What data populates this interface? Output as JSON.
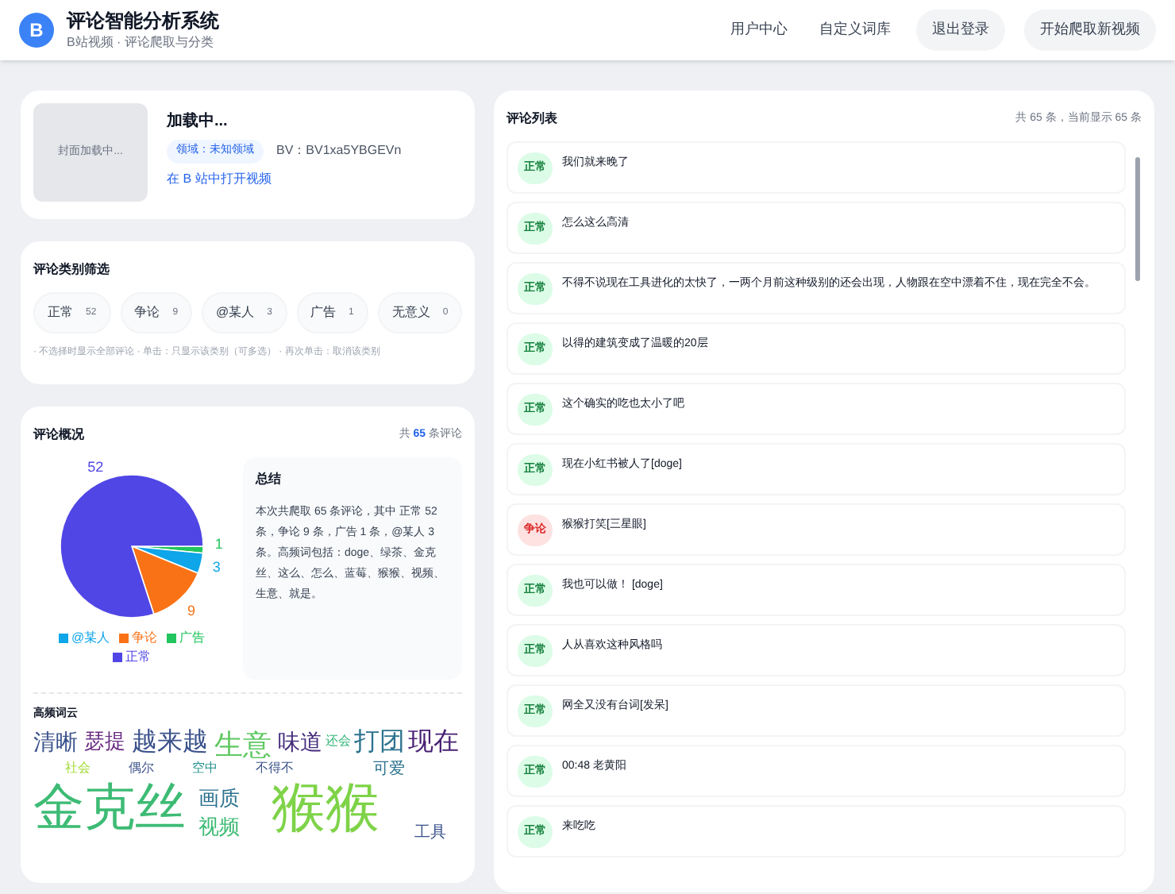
{
  "header": {
    "logo": "B",
    "title": "评论智能分析系统",
    "subtitle": "B站视频 · 评论爬取与分类",
    "nav": [
      "用户中心",
      "自定义词库"
    ],
    "buttons": [
      "退出登录",
      "开始爬取新视频"
    ]
  },
  "video": {
    "thumbnail": "封面加载中...",
    "title": "加载中...",
    "tag": "领域：未知领域",
    "bv": "BV：BV1xa5YBGEVn",
    "link": "在 B 站中打开视频"
  },
  "filter": {
    "title": "评论类别筛选",
    "chips": [
      {
        "label": "正常",
        "count": "52",
        "selected": false
      },
      {
        "label": "争论",
        "count": "9",
        "selected": false
      },
      {
        "label": "@某人",
        "count": "3",
        "selected": false
      },
      {
        "label": "广告",
        "count": "1",
        "selected": false
      },
      {
        "label": "无意义",
        "count": "0",
        "selected": false
      }
    ],
    "hint": "· 不选择时显示全部评论 · 单击：只显示该类别（可多选） · 再次单击：取消该类别"
  },
  "overview": {
    "title": "评论概况",
    "total_prefix": "共",
    "total": "65",
    "total_suffix": "条评论",
    "chart_data": {
      "type": "pie",
      "categories": [
        "广告",
        "@某人",
        "争论",
        "正常"
      ],
      "series": [
        {
          "values": [
            1,
            3,
            9,
            52
          ]
        }
      ],
      "colors": [
        "#22c55e",
        "#0ea5e9",
        "#f97316",
        "#5046e5"
      ],
      "data_labels": true,
      "legend": [
        "@某人",
        "争论",
        "广告",
        "正常"
      ]
    },
    "summary_title": "总结",
    "summary": "本次共爬取 65 条评论，其中 正常 52 条，争论 9 条，广告 1 条，@某人 3 条。高频词包括：doge、绿茶、金克丝、这么、怎么、蓝莓、猴猴、视频、生意、就是。"
  },
  "wordcloud": {
    "title": "高频词云",
    "words": [
      {
        "text": "金克丝",
        "color": "#3dbb74"
      },
      {
        "text": "猴猴",
        "color": "#7ed348"
      },
      {
        "text": "清晰",
        "color": "#3b528b"
      },
      {
        "text": "瑟提",
        "color": "#6a2c82"
      },
      {
        "text": "越来越",
        "color": "#3b528b"
      },
      {
        "text": "生意",
        "color": "#5ec962"
      },
      {
        "text": "味道",
        "color": "#472d7b"
      },
      {
        "text": "还会",
        "color": "#35b779"
      },
      {
        "text": "打团",
        "color": "#2c728e"
      },
      {
        "text": "现在",
        "color": "#482173"
      },
      {
        "text": "社会",
        "color": "#a2da37"
      },
      {
        "text": "偶尔",
        "color": "#3b528b"
      },
      {
        "text": "空中",
        "color": "#21918c"
      },
      {
        "text": "画质",
        "color": "#2c728e"
      },
      {
        "text": "视频",
        "color": "#3dbb74"
      },
      {
        "text": "不得不",
        "color": "#3b528b"
      },
      {
        "text": "可爱",
        "color": "#2c728e"
      },
      {
        "text": "工具",
        "color": "#3b528b"
      }
    ]
  },
  "comments": {
    "title": "评论列表",
    "count": "共 65 条，当前显示 65 条",
    "items": [
      {
        "kind": "normal",
        "tag": "正常",
        "text": "我们就来晚了"
      },
      {
        "kind": "normal",
        "tag": "正常",
        "text": "怎么这么高清"
      },
      {
        "kind": "normal",
        "tag": "正常",
        "text": "不得不说现在工具进化的太快了，一两个月前这种级别的还会出现，人物跟在空中漂着不住，现在完全不会。"
      },
      {
        "kind": "normal",
        "tag": "正常",
        "text": "以得的建筑变成了温暖的20层"
      },
      {
        "kind": "normal",
        "tag": "正常",
        "text": "这个确实的吃也太小了吧"
      },
      {
        "kind": "normal",
        "tag": "正常",
        "text": "现在小红书被人了[doge]"
      },
      {
        "kind": "dispute",
        "tag": "争论",
        "text": "猴猴打笑[三星眼]"
      },
      {
        "kind": "normal",
        "tag": "正常",
        "text": "我也可以做！ [doge]"
      },
      {
        "kind": "normal",
        "tag": "正常",
        "text": "人从喜欢这种风格吗"
      },
      {
        "kind": "normal",
        "tag": "正常",
        "text": "网全又没有台词[发呆]"
      },
      {
        "kind": "normal",
        "tag": "正常",
        "text": "00:48 老黄阳"
      },
      {
        "kind": "normal",
        "tag": "正常",
        "text": "来吃吃"
      }
    ]
  }
}
